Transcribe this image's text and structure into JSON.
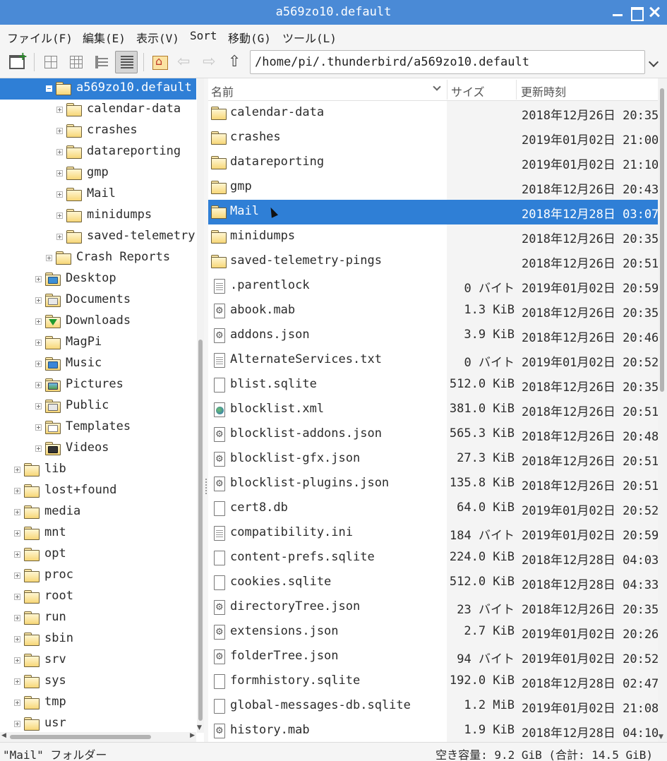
{
  "window": {
    "title": "a569zo10.default"
  },
  "menu": [
    "ファイル(F)",
    "編集(E)",
    "表示(V)",
    "Sort",
    "移動(G)",
    "ツール(L)"
  ],
  "toolbar": {
    "path": "/home/pi/.thunderbird/a569zo10.default"
  },
  "tree": [
    {
      "label": "a569zo10.default",
      "level": 4,
      "expander": "minus",
      "icon": "folder",
      "selected": true
    },
    {
      "label": "calendar-data",
      "level": 5,
      "expander": "plus",
      "icon": "folder"
    },
    {
      "label": "crashes",
      "level": 5,
      "expander": "plus",
      "icon": "folder"
    },
    {
      "label": "datareporting",
      "level": 5,
      "expander": "plus",
      "icon": "folder"
    },
    {
      "label": "gmp",
      "level": 5,
      "expander": "plus",
      "icon": "folder"
    },
    {
      "label": "Mail",
      "level": 5,
      "expander": "plus",
      "icon": "folder"
    },
    {
      "label": "minidumps",
      "level": 5,
      "expander": "plus",
      "icon": "folder"
    },
    {
      "label": "saved-telemetry-",
      "level": 5,
      "expander": "plus",
      "icon": "folder"
    },
    {
      "label": "Crash Reports",
      "level": 4,
      "expander": "plus",
      "icon": "folder"
    },
    {
      "label": "Desktop",
      "level": 3,
      "expander": "plus",
      "icon": "desk"
    },
    {
      "label": "Documents",
      "level": 3,
      "expander": "plus",
      "icon": "docs"
    },
    {
      "label": "Downloads",
      "level": 3,
      "expander": "plus",
      "icon": "down"
    },
    {
      "label": "MagPi",
      "level": 3,
      "expander": "plus",
      "icon": "folder"
    },
    {
      "label": "Music",
      "level": 3,
      "expander": "plus",
      "icon": "music"
    },
    {
      "label": "Pictures",
      "level": 3,
      "expander": "plus",
      "icon": "pics"
    },
    {
      "label": "Public",
      "level": 3,
      "expander": "plus",
      "icon": "pub"
    },
    {
      "label": "Templates",
      "level": 3,
      "expander": "plus",
      "icon": "tmpl"
    },
    {
      "label": "Videos",
      "level": 3,
      "expander": "plus",
      "icon": "vids"
    },
    {
      "label": "lib",
      "level": 1,
      "expander": "plus",
      "icon": "folder"
    },
    {
      "label": "lost+found",
      "level": 1,
      "expander": "plus",
      "icon": "folder"
    },
    {
      "label": "media",
      "level": 1,
      "expander": "plus",
      "icon": "folder"
    },
    {
      "label": "mnt",
      "level": 1,
      "expander": "plus",
      "icon": "folder"
    },
    {
      "label": "opt",
      "level": 1,
      "expander": "plus",
      "icon": "folder"
    },
    {
      "label": "proc",
      "level": 1,
      "expander": "plus",
      "icon": "folder"
    },
    {
      "label": "root",
      "level": 1,
      "expander": "plus",
      "icon": "folder"
    },
    {
      "label": "run",
      "level": 1,
      "expander": "plus",
      "icon": "folder"
    },
    {
      "label": "sbin",
      "level": 1,
      "expander": "plus",
      "icon": "folder"
    },
    {
      "label": "srv",
      "level": 1,
      "expander": "plus",
      "icon": "folder"
    },
    {
      "label": "sys",
      "level": 1,
      "expander": "plus",
      "icon": "folder"
    },
    {
      "label": "tmp",
      "level": 1,
      "expander": "plus",
      "icon": "folder"
    },
    {
      "label": "usr",
      "level": 1,
      "expander": "plus",
      "icon": "folder"
    }
  ],
  "list": {
    "columns": {
      "name": "名前",
      "size": "サイズ",
      "modified": "更新時刻"
    },
    "rows": [
      {
        "name": "calendar-data",
        "size": "",
        "modified": "2018年12月26日 20:35",
        "icon": "folder"
      },
      {
        "name": "crashes",
        "size": "",
        "modified": "2019年01月02日 21:00",
        "icon": "folder"
      },
      {
        "name": "datareporting",
        "size": "",
        "modified": "2019年01月02日 21:10",
        "icon": "folder"
      },
      {
        "name": "gmp",
        "size": "",
        "modified": "2018年12月26日 20:43",
        "icon": "folder"
      },
      {
        "name": "Mail",
        "size": "",
        "modified": "2018年12月28日 03:07",
        "icon": "folder",
        "selected": true
      },
      {
        "name": "minidumps",
        "size": "",
        "modified": "2018年12月26日 20:35",
        "icon": "folder"
      },
      {
        "name": "saved-telemetry-pings",
        "size": "",
        "modified": "2018年12月26日 20:51",
        "icon": "folder"
      },
      {
        "name": ".parentlock",
        "size": "0 バイト",
        "modified": "2019年01月02日 20:59",
        "icon": "text"
      },
      {
        "name": "abook.mab",
        "size": "1.3 KiB",
        "modified": "2018年12月26日 20:35",
        "icon": "gear"
      },
      {
        "name": "addons.json",
        "size": "3.9 KiB",
        "modified": "2018年12月26日 20:46",
        "icon": "gear"
      },
      {
        "name": "AlternateServices.txt",
        "size": "0 バイト",
        "modified": "2019年01月02日 20:52",
        "icon": "text"
      },
      {
        "name": "blist.sqlite",
        "size": "512.0 KiB",
        "modified": "2018年12月26日 20:35",
        "icon": "blank"
      },
      {
        "name": "blocklist.xml",
        "size": "381.0 KiB",
        "modified": "2018年12月26日 20:51",
        "icon": "xml"
      },
      {
        "name": "blocklist-addons.json",
        "size": "565.3 KiB",
        "modified": "2018年12月26日 20:48",
        "icon": "gear"
      },
      {
        "name": "blocklist-gfx.json",
        "size": "27.3 KiB",
        "modified": "2018年12月26日 20:51",
        "icon": "gear"
      },
      {
        "name": "blocklist-plugins.json",
        "size": "135.8 KiB",
        "modified": "2018年12月26日 20:51",
        "icon": "gear"
      },
      {
        "name": "cert8.db",
        "size": "64.0 KiB",
        "modified": "2019年01月02日 20:52",
        "icon": "blank"
      },
      {
        "name": "compatibility.ini",
        "size": "184 バイト",
        "modified": "2019年01月02日 20:59",
        "icon": "text"
      },
      {
        "name": "content-prefs.sqlite",
        "size": "224.0 KiB",
        "modified": "2018年12月28日 04:03",
        "icon": "blank"
      },
      {
        "name": "cookies.sqlite",
        "size": "512.0 KiB",
        "modified": "2018年12月28日 04:33",
        "icon": "blank"
      },
      {
        "name": "directoryTree.json",
        "size": "23 バイト",
        "modified": "2018年12月26日 20:35",
        "icon": "gear"
      },
      {
        "name": "extensions.json",
        "size": "2.7 KiB",
        "modified": "2019年01月02日 20:26",
        "icon": "gear"
      },
      {
        "name": "folderTree.json",
        "size": "94 バイト",
        "modified": "2019年01月02日 20:52",
        "icon": "gear"
      },
      {
        "name": "formhistory.sqlite",
        "size": "192.0 KiB",
        "modified": "2018年12月28日 02:47",
        "icon": "blank"
      },
      {
        "name": "global-messages-db.sqlite",
        "size": "1.2 MiB",
        "modified": "2019年01月02日 21:08",
        "icon": "blank"
      },
      {
        "name": "history.mab",
        "size": "1.9 KiB",
        "modified": "2018年12月28日 04:10",
        "icon": "gear"
      }
    ]
  },
  "status": {
    "left": "\"Mail\" フォルダー",
    "right": "空き容量: 9.2 GiB (合計: 14.5 GiB)"
  }
}
